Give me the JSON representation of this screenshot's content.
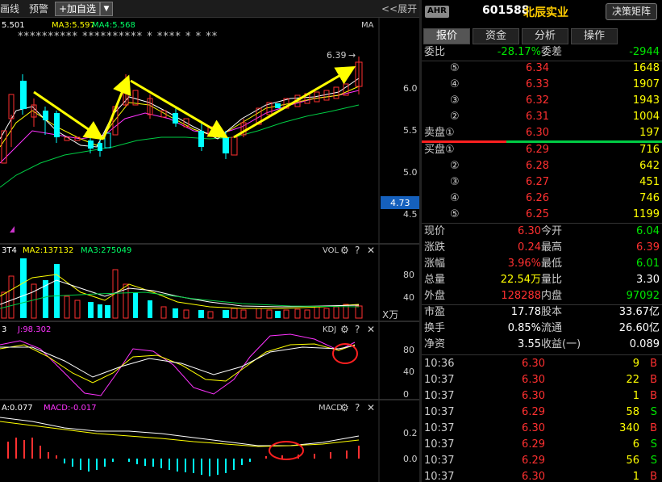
{
  "toolbar": {
    "draw_label": "画线",
    "alert_label": "预警",
    "add_fav_label": "+加自选",
    "dropdown_label": "▼",
    "expand_label": "<<展开"
  },
  "chart": {
    "ma_header": {
      "ma1": "5.501",
      "ma3": "MA3:5.597",
      "ma4": "MA4:5.568",
      "right": "MA"
    },
    "stars": "**********  **********   *   ****  *  *     **",
    "high_label": "6.39",
    "price_ticks": [
      "6.0",
      "5.5",
      "5.0",
      "4.5"
    ],
    "current_price_tag": "4.73",
    "vol_header": {
      "a": "3T4",
      "b": "MA2:137132",
      "c": "MA3:275049",
      "name": "VOL"
    },
    "vol_ticks": [
      "80",
      "40"
    ],
    "vol_unit": "X万",
    "kdj_header": {
      "a": "3",
      "b": "J:98.302",
      "name": "KDJ"
    },
    "kdj_ticks": [
      "80",
      "40",
      "0"
    ],
    "macd_header": {
      "a": "A:0.077",
      "b": "MACD:-0.017",
      "name": "MACD"
    },
    "macd_ticks": [
      "0.2",
      "0.0"
    ],
    "icons": {
      "gear": "⚙",
      "help": "?",
      "close": "✕"
    }
  },
  "panel": {
    "badge": "AHR",
    "code": "601588",
    "name": "北辰实业",
    "decision_btn": "决策矩阵",
    "tabs": [
      "报价",
      "资金",
      "分析",
      "操作"
    ],
    "weibi": {
      "label": "委比",
      "value": "-28.17%",
      "label2": "委差",
      "value2": "-2944"
    },
    "sell": [
      {
        "label": "⑤",
        "price": "6.34",
        "vol": "1648"
      },
      {
        "label": "④",
        "price": "6.33",
        "vol": "1907"
      },
      {
        "label": "③",
        "price": "6.32",
        "vol": "1943"
      },
      {
        "label": "②",
        "price": "6.31",
        "vol": "1004"
      },
      {
        "label": "卖盘①",
        "price": "6.30",
        "vol": "197"
      }
    ],
    "buy": [
      {
        "label": "买盘①",
        "price": "6.29",
        "vol": "716"
      },
      {
        "label": "②",
        "price": "6.28",
        "vol": "642"
      },
      {
        "label": "③",
        "price": "6.27",
        "vol": "451"
      },
      {
        "label": "④",
        "price": "6.26",
        "vol": "746"
      },
      {
        "label": "⑤",
        "price": "6.25",
        "vol": "1199"
      }
    ],
    "stats": [
      {
        "l1": "现价",
        "v1": "6.30",
        "c1": "red",
        "l2": "今开",
        "v2": "6.04",
        "c2": "grn"
      },
      {
        "l1": "涨跌",
        "v1": "0.24",
        "c1": "red",
        "l2": "最高",
        "v2": "6.39",
        "c2": "red"
      },
      {
        "l1": "涨幅",
        "v1": "3.96%",
        "c1": "red",
        "l2": "最低",
        "v2": "6.01",
        "c2": "grn"
      },
      {
        "l1": "总量",
        "v1": "22.54万",
        "c1": "yel",
        "l2": "量比",
        "v2": "3.30",
        "c2": "wht"
      },
      {
        "l1": "外盘",
        "v1": "128288",
        "c1": "red",
        "l2": "内盘",
        "v2": "97092",
        "c2": "grn"
      }
    ],
    "stats2": [
      {
        "l1": "市盈",
        "v1": "17.78",
        "l2": "股本",
        "v2": "33.67亿"
      },
      {
        "l1": "换手",
        "v1": "0.85%",
        "l2": "流通",
        "v2": "26.60亿"
      },
      {
        "l1": "净资",
        "v1": "3.55",
        "l2": "收益(一)",
        "v2": "0.089"
      }
    ],
    "ticks": [
      {
        "t": "10:36",
        "p": "6.30",
        "v": "9",
        "s": "B"
      },
      {
        "t": "10:37",
        "p": "6.30",
        "v": "22",
        "s": "B"
      },
      {
        "t": "10:37",
        "p": "6.30",
        "v": "1",
        "s": "B"
      },
      {
        "t": "10:37",
        "p": "6.29",
        "v": "58",
        "s": "S"
      },
      {
        "t": "10:37",
        "p": "6.30",
        "v": "340",
        "s": "B"
      },
      {
        "t": "10:37",
        "p": "6.29",
        "v": "6",
        "s": "S"
      },
      {
        "t": "10:37",
        "p": "6.29",
        "v": "56",
        "s": "S"
      },
      {
        "t": "10:37",
        "p": "6.30",
        "v": "1",
        "s": "B"
      }
    ],
    "colors": {
      "up": "#ff3030",
      "down": "#00e600",
      "accent": "#ffff00"
    }
  }
}
